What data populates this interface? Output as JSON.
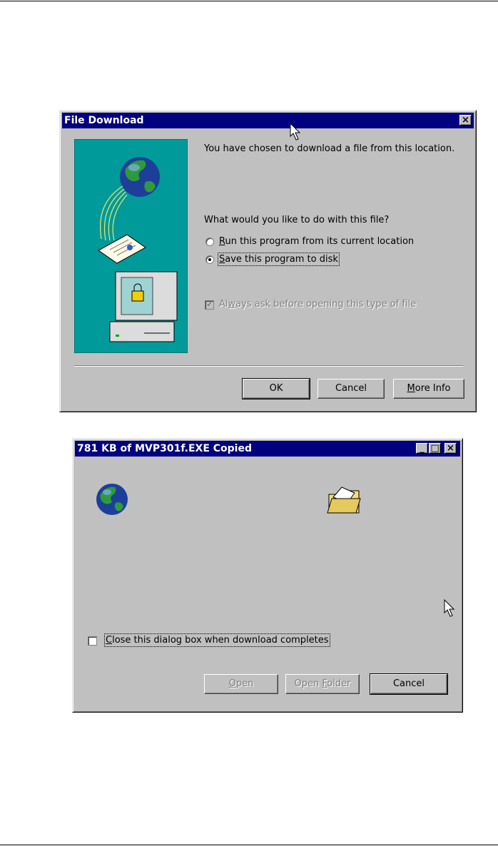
{
  "file_download": {
    "title": "File Download",
    "close_symbol": "×",
    "message": "You have chosen to download a file from this location.",
    "question": "What would you like to do with this file?",
    "option_run": {
      "mnemonic": "R",
      "rest": "un this program from its current location",
      "selected": false
    },
    "option_save": {
      "mnemonic": "S",
      "rest": "ave this program to disk",
      "selected": true
    },
    "always_ask": {
      "before": "Al",
      "mnemonic": "w",
      "rest": "ays ask before opening this type of file",
      "checked": true,
      "disabled": true
    },
    "buttons": {
      "ok": "OK",
      "cancel": "Cancel",
      "more_info_mnemonic": "M",
      "more_info_rest": "ore Info"
    },
    "illustration_icons": [
      "globe-icon",
      "document-icon",
      "computer-lock-icon"
    ],
    "illustration_bg": "#009a9a"
  },
  "progress_dialog": {
    "title": "781 KB of MVP301f.EXE Copied",
    "minimize_symbol": "_",
    "maximize_symbol": "□",
    "close_symbol": "×",
    "source_icon": "globe-icon",
    "dest_icon": "folder-icon",
    "close_when_done": {
      "mnemonic": "C",
      "rest": "lose this dialog box when download completes",
      "checked": false
    },
    "buttons": {
      "open_mnemonic": "O",
      "open_rest": "pen",
      "open_folder_before": "Open ",
      "open_folder_mnemonic": "F",
      "open_folder_rest": "older",
      "cancel": "Cancel"
    }
  },
  "colors": {
    "titlebar": "#000080",
    "face": "#c0c0c0",
    "teal": "#009a9a"
  }
}
